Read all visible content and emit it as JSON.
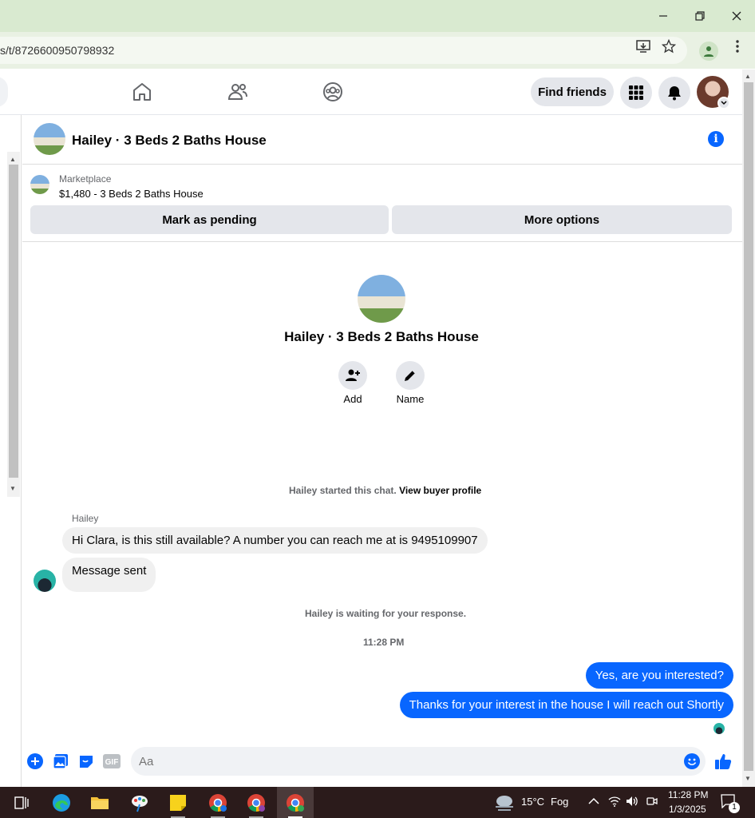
{
  "browser": {
    "url_fragment": "s/t/8726600950798932"
  },
  "nav": {
    "find_friends_label": "Find friends"
  },
  "chat": {
    "title": "Hailey · 3 Beds 2 Baths House",
    "marketplace_label": "Marketplace",
    "listing": "$1,480 - 3 Beds 2 Baths House",
    "mark_pending_label": "Mark as pending",
    "more_options_label": "More options",
    "intro_title": "Hailey · 3 Beds 2 Baths House",
    "add_label": "Add",
    "name_label": "Name",
    "started_text": "Hailey started this chat.",
    "view_buyer_profile": "View buyer profile",
    "sender_name": "Hailey",
    "messages_in": [
      "Hi Clara, is this still available? A number you can reach me at is 9495109907",
      "Message sent"
    ],
    "waiting_text": "Hailey is waiting for your response.",
    "timestamp": "11:28 PM",
    "messages_out": [
      "Yes, are you interested?",
      "Thanks for your interest in the house I will reach out Shortly"
    ],
    "composer_placeholder": "Aa",
    "accent_color": "#0866ff"
  },
  "taskbar": {
    "weather_temp": "15°C",
    "weather_desc": "Fog",
    "time": "11:28 PM",
    "date": "1/3/2025",
    "notification_count": "1"
  }
}
